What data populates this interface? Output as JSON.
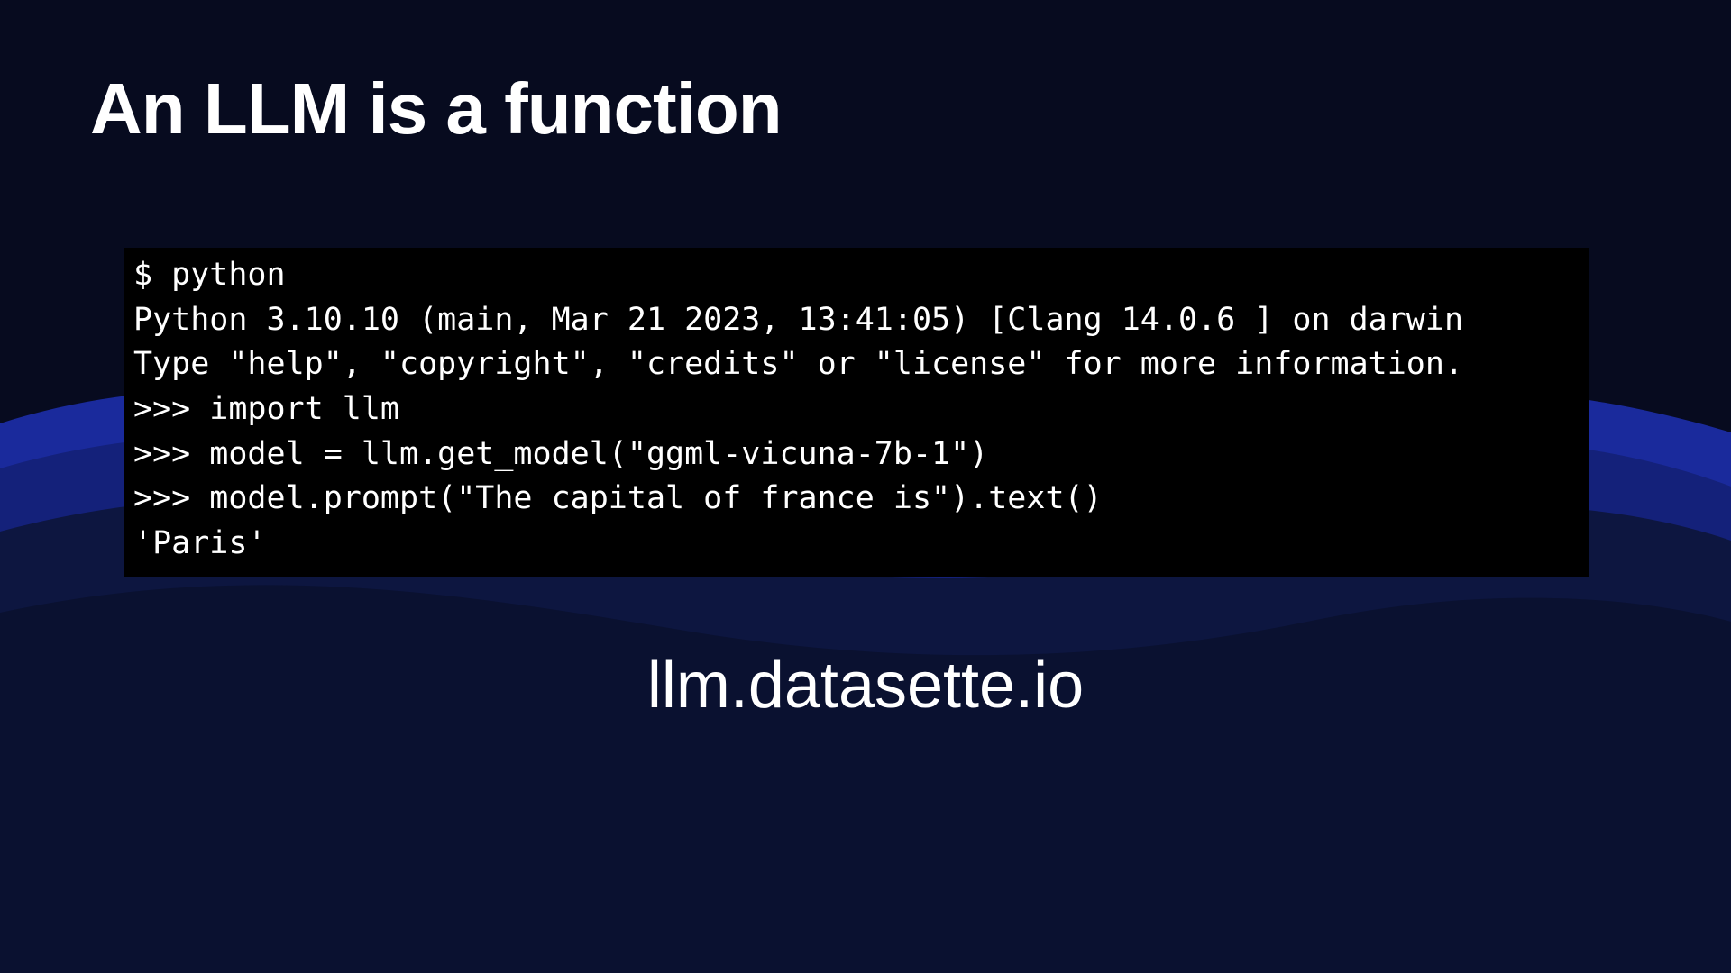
{
  "title": "An LLM is a function",
  "terminal": {
    "lines": [
      "$ python",
      "Python 3.10.10 (main, Mar 21 2023, 13:41:05) [Clang 14.0.6 ] on darwin",
      "Type \"help\", \"copyright\", \"credits\" or \"license\" for more information.",
      ">>> import llm",
      ">>> model = llm.get_model(\"ggml-vicuna-7b-1\")",
      ">>> model.prompt(\"The capital of france is\").text()",
      "'Paris'"
    ]
  },
  "footer": "llm.datasette.io",
  "colors": {
    "bg_top": "#070b1f",
    "bg_wave_dark": "#0d1640",
    "bg_wave_mid": "#14217a",
    "bg_wave_light": "#1f33c8",
    "terminal_bg": "#000000",
    "text": "#ffffff"
  }
}
